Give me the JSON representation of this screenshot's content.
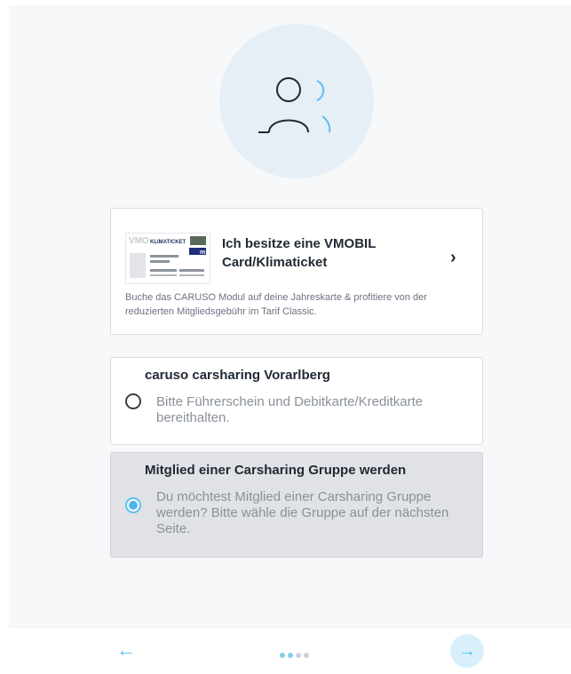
{
  "colors": {
    "accent": "#5bc0f0",
    "hero_bg": "#e6eef6",
    "selected_bg": "#e0e2e6"
  },
  "hero": {
    "icon": "users-icon"
  },
  "vmobil_card": {
    "thumbnail": {
      "brand_text": "VMOBIL",
      "ticket_text": "KLIMATICKET",
      "badge_text": "m"
    },
    "title": "Ich besitze eine VMOBIL Card/Klimaticket",
    "chevron_icon": "chevron-right-icon",
    "description": "Buche das CARUSO Modul auf deine Jahreskarte & profitiere von der reduzierten Mitgliedsgebühr im Tarif Classic."
  },
  "options": [
    {
      "title": "caruso carsharing Vorarlberg",
      "description": "Bitte Führerschein und Debitkarte/Kreditkarte bereithalten.",
      "selected": false
    },
    {
      "title": "Mitglied einer Carsharing Gruppe werden",
      "description": "Du möchtest Mitglied einer Carsharing Gruppe werden? Bitte wähle die Gruppe auf der nächsten Seite.",
      "selected": true
    }
  ],
  "footer": {
    "back_icon": "arrow-left-icon",
    "back_glyph": "←",
    "next_icon": "arrow-right-icon",
    "next_glyph": "→",
    "step_count": 4
  }
}
